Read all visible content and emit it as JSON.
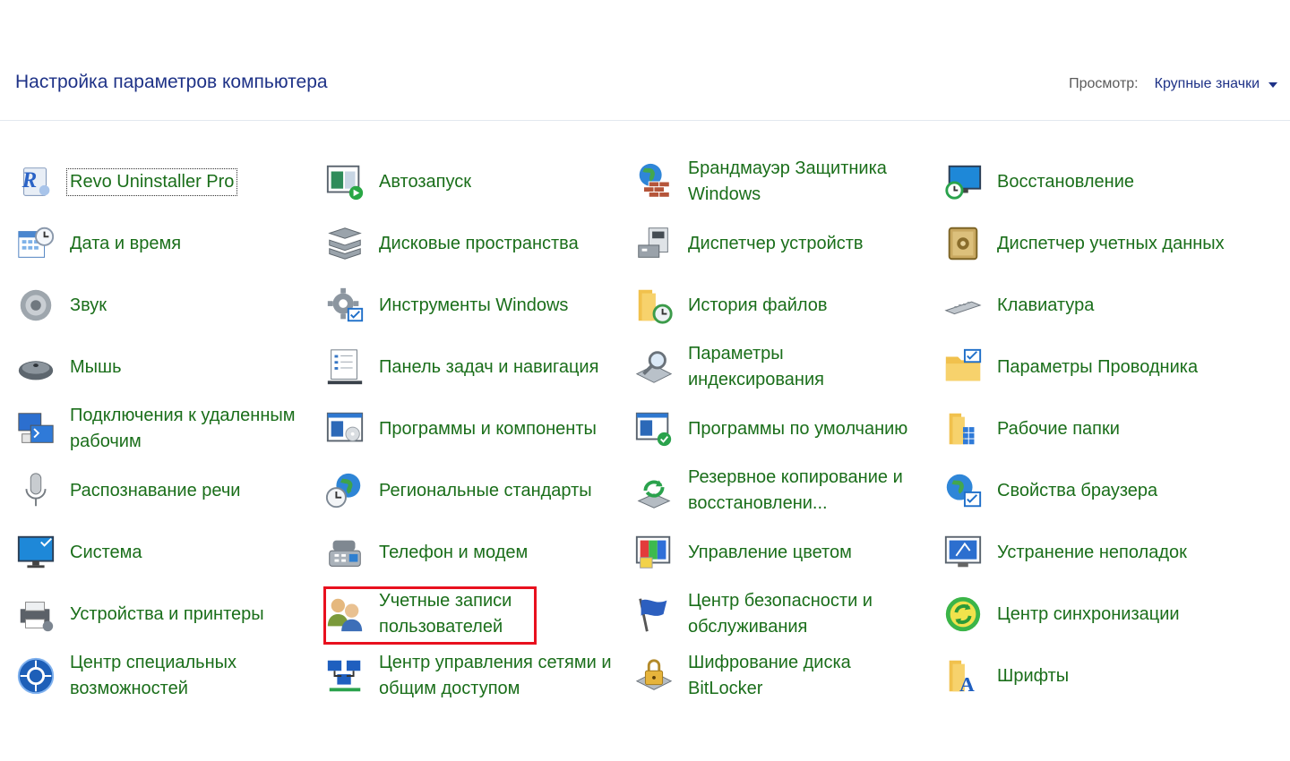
{
  "header": {
    "title": "Настройка параметров компьютера",
    "view_label": "Просмотр:",
    "view_value": "Крупные значки"
  },
  "items": [
    {
      "label": "Revo Uninstaller Pro",
      "icon": "revo-uninstaller-icon"
    },
    {
      "label": "Дата и время",
      "icon": "calendar-clock-icon"
    },
    {
      "label": "Звук",
      "icon": "speaker-icon"
    },
    {
      "label": "Мышь",
      "icon": "mouse-icon"
    },
    {
      "label": "Подключения к удаленным рабочим",
      "icon": "remote-desktop-icon"
    },
    {
      "label": "Распознавание речи",
      "icon": "microphone-icon"
    },
    {
      "label": "Система",
      "icon": "monitor-check-icon"
    },
    {
      "label": "Устройства и принтеры",
      "icon": "printer-icon"
    },
    {
      "label": "Центр специальных возможностей",
      "icon": "accessibility-icon"
    },
    {
      "label": "Автозапуск",
      "icon": "autoplay-icon"
    },
    {
      "label": "Дисковые пространства",
      "icon": "storage-spaces-icon"
    },
    {
      "label": "Инструменты Windows",
      "icon": "gear-tools-icon"
    },
    {
      "label": "Панель задач и навигация",
      "icon": "taskbar-icon"
    },
    {
      "label": "Программы и компоненты",
      "icon": "programs-icon"
    },
    {
      "label": "Региональные стандарты",
      "icon": "globe-clock-icon"
    },
    {
      "label": "Телефон и модем",
      "icon": "phone-modem-icon"
    },
    {
      "label": "Учетные записи пользователей",
      "icon": "users-icon"
    },
    {
      "label": "Центр управления сетями и общим доступом",
      "icon": "network-icon"
    },
    {
      "label": "Брандмауэр Защитника Windows",
      "icon": "firewall-icon"
    },
    {
      "label": "Диспетчер устройств",
      "icon": "device-manager-icon"
    },
    {
      "label": "История файлов",
      "icon": "file-history-icon"
    },
    {
      "label": "Параметры индексирования",
      "icon": "indexing-icon"
    },
    {
      "label": "Программы по умолчанию",
      "icon": "default-programs-icon"
    },
    {
      "label": "Резервное копирование и восстановлени...",
      "icon": "backup-icon"
    },
    {
      "label": "Управление цветом",
      "icon": "color-management-icon"
    },
    {
      "label": "Центр безопасности и обслуживания",
      "icon": "flag-icon"
    },
    {
      "label": "Шифрование диска BitLocker",
      "icon": "bitlocker-icon"
    },
    {
      "label": "Восстановление",
      "icon": "recovery-icon"
    },
    {
      "label": "Диспетчер учетных данных",
      "icon": "credential-safe-icon"
    },
    {
      "label": "Клавиатура",
      "icon": "keyboard-icon"
    },
    {
      "label": "Параметры Проводника",
      "icon": "folder-check-icon"
    },
    {
      "label": "Рабочие папки",
      "icon": "work-folders-icon"
    },
    {
      "label": "Свойства браузера",
      "icon": "internet-options-icon"
    },
    {
      "label": "Устранение неполадок",
      "icon": "troubleshoot-icon"
    },
    {
      "label": "Центр синхронизации",
      "icon": "sync-icon"
    },
    {
      "label": "Шрифты",
      "icon": "fonts-icon"
    }
  ]
}
